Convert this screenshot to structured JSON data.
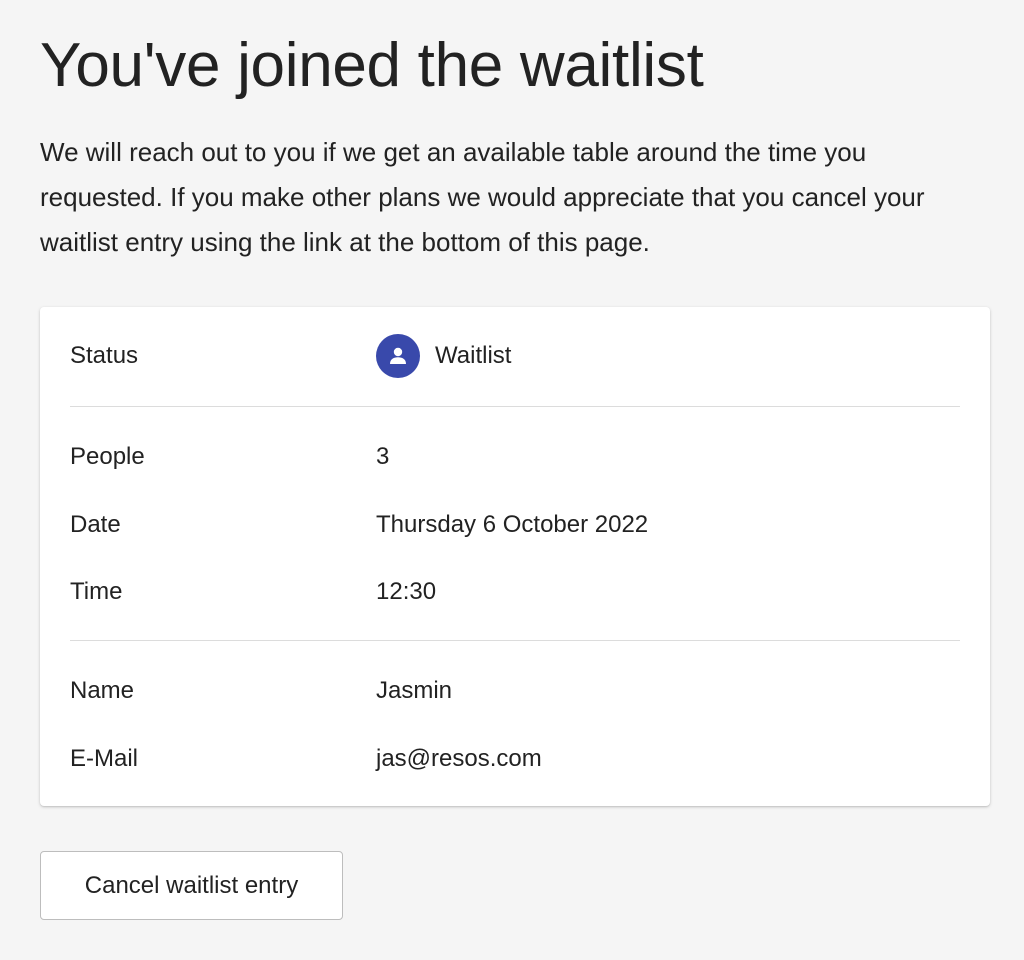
{
  "title": "You've joined the waitlist",
  "intro": "We will reach out to you if we get an available table around the time you requested. If you make other plans we would appreciate that you cancel your waitlist entry using the link at the bottom of this page.",
  "details": {
    "status": {
      "label": "Status",
      "value": "Waitlist",
      "icon": "person-icon",
      "icon_color": "#3949ab"
    },
    "people": {
      "label": "People",
      "value": "3"
    },
    "date": {
      "label": "Date",
      "value": "Thursday 6 October 2022"
    },
    "time": {
      "label": "Time",
      "value": "12:30"
    },
    "name": {
      "label": "Name",
      "value": "Jasmin"
    },
    "email": {
      "label": "E-Mail",
      "value": "jas@resos.com"
    }
  },
  "actions": {
    "cancel_label": "Cancel waitlist entry"
  }
}
